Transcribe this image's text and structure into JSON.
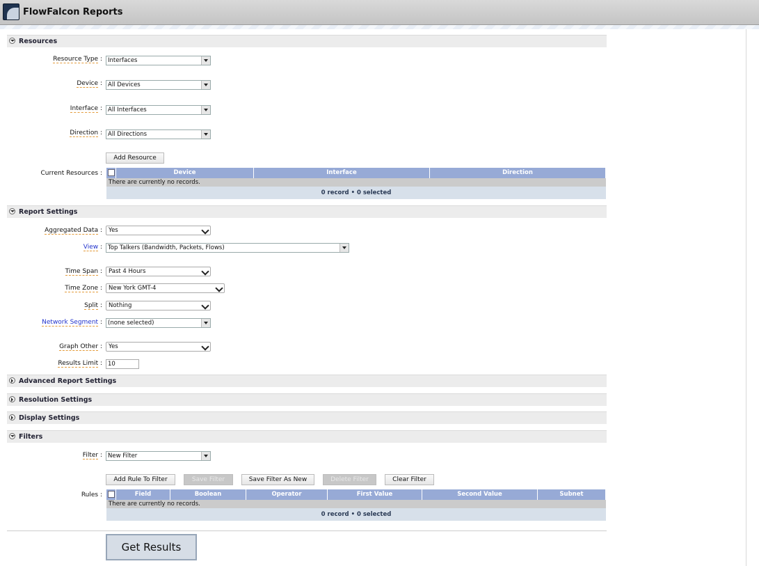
{
  "app": {
    "title": "FlowFalcon Reports",
    "logo_icon": "flowfalcon-logo-icon"
  },
  "sections": {
    "resources": "Resources",
    "report_settings": "Report Settings",
    "advanced": "Advanced Report Settings",
    "resolution": "Resolution Settings",
    "display": "Display Settings",
    "filters": "Filters"
  },
  "resources": {
    "resource_type": {
      "label": "Resource Type",
      "value": "Interfaces"
    },
    "device": {
      "label": "Device",
      "value": "All Devices"
    },
    "interface": {
      "label": "Interface",
      "value": "All Interfaces"
    },
    "direction": {
      "label": "Direction",
      "value": "All Directions"
    },
    "add_button": "Add Resource",
    "current_label": "Current Resources",
    "table": {
      "columns": [
        "Device",
        "Interface",
        "Direction"
      ],
      "empty": "There are currently no records.",
      "footer": "0 record • 0 selected"
    }
  },
  "report": {
    "aggregated": {
      "label": "Aggregated Data",
      "value": "Yes"
    },
    "view": {
      "label": "View",
      "value": "Top Talkers (Bandwidth, Packets, Flows)"
    },
    "time_span": {
      "label": "Time Span",
      "value": "Past 4 Hours"
    },
    "time_zone": {
      "label": "Time Zone",
      "value": "New York GMT-4"
    },
    "split": {
      "label": "Split",
      "value": "Nothing"
    },
    "network_segment": {
      "label": "Network Segment",
      "value": "(none selected)"
    },
    "graph_other": {
      "label": "Graph Other",
      "value": "Yes"
    },
    "results_limit": {
      "label": "Results Limit",
      "value": "10"
    }
  },
  "filters": {
    "filter": {
      "label": "Filter",
      "value": "New Filter"
    },
    "buttons": {
      "add_rule": "Add Rule To Filter",
      "save": "Save Filter",
      "save_as_new": "Save Filter As New",
      "delete": "Delete Filter",
      "clear": "Clear Filter"
    },
    "rules_label": "Rules",
    "table": {
      "columns": [
        "Field",
        "Boolean",
        "Operator",
        "First Value",
        "Second Value",
        "Subnet"
      ],
      "empty": "There are currently no records.",
      "footer": "0 record • 0 selected"
    }
  },
  "get_results": "Get Results",
  "colors": {
    "grid_header": "#97aad6",
    "grid_footer": "#d7e0ea",
    "label_underline": "#e39b3a"
  }
}
